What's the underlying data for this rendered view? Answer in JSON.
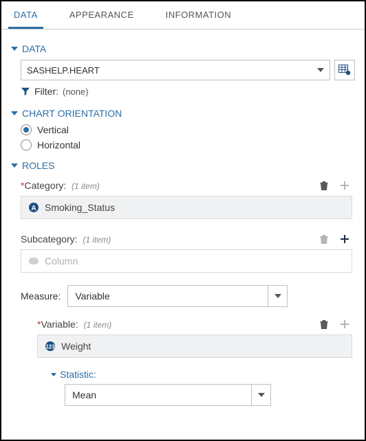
{
  "tabs": {
    "data": "DATA",
    "appearance": "APPEARANCE",
    "information": "INFORMATION"
  },
  "sections": {
    "data": {
      "title": "DATA",
      "dataset": "SASHELP.HEART",
      "filter_label": "Filter:",
      "filter_value": "(none)"
    },
    "orientation": {
      "title": "CHART ORIENTATION",
      "vertical": "Vertical",
      "horizontal": "Horizontal"
    },
    "roles": {
      "title": "ROLES",
      "category": {
        "label": "Category:",
        "hint": "(1 item)",
        "value": "Smoking_Status"
      },
      "subcategory": {
        "label": "Subcategory:",
        "hint": "(1 item)",
        "placeholder": "Column"
      },
      "measure": {
        "label": "Measure:",
        "value": "Variable"
      },
      "variable": {
        "label": "Variable:",
        "hint": "(1 item)",
        "value": "Weight"
      },
      "statistic": {
        "label": "Statistic:",
        "value": "Mean"
      }
    }
  }
}
